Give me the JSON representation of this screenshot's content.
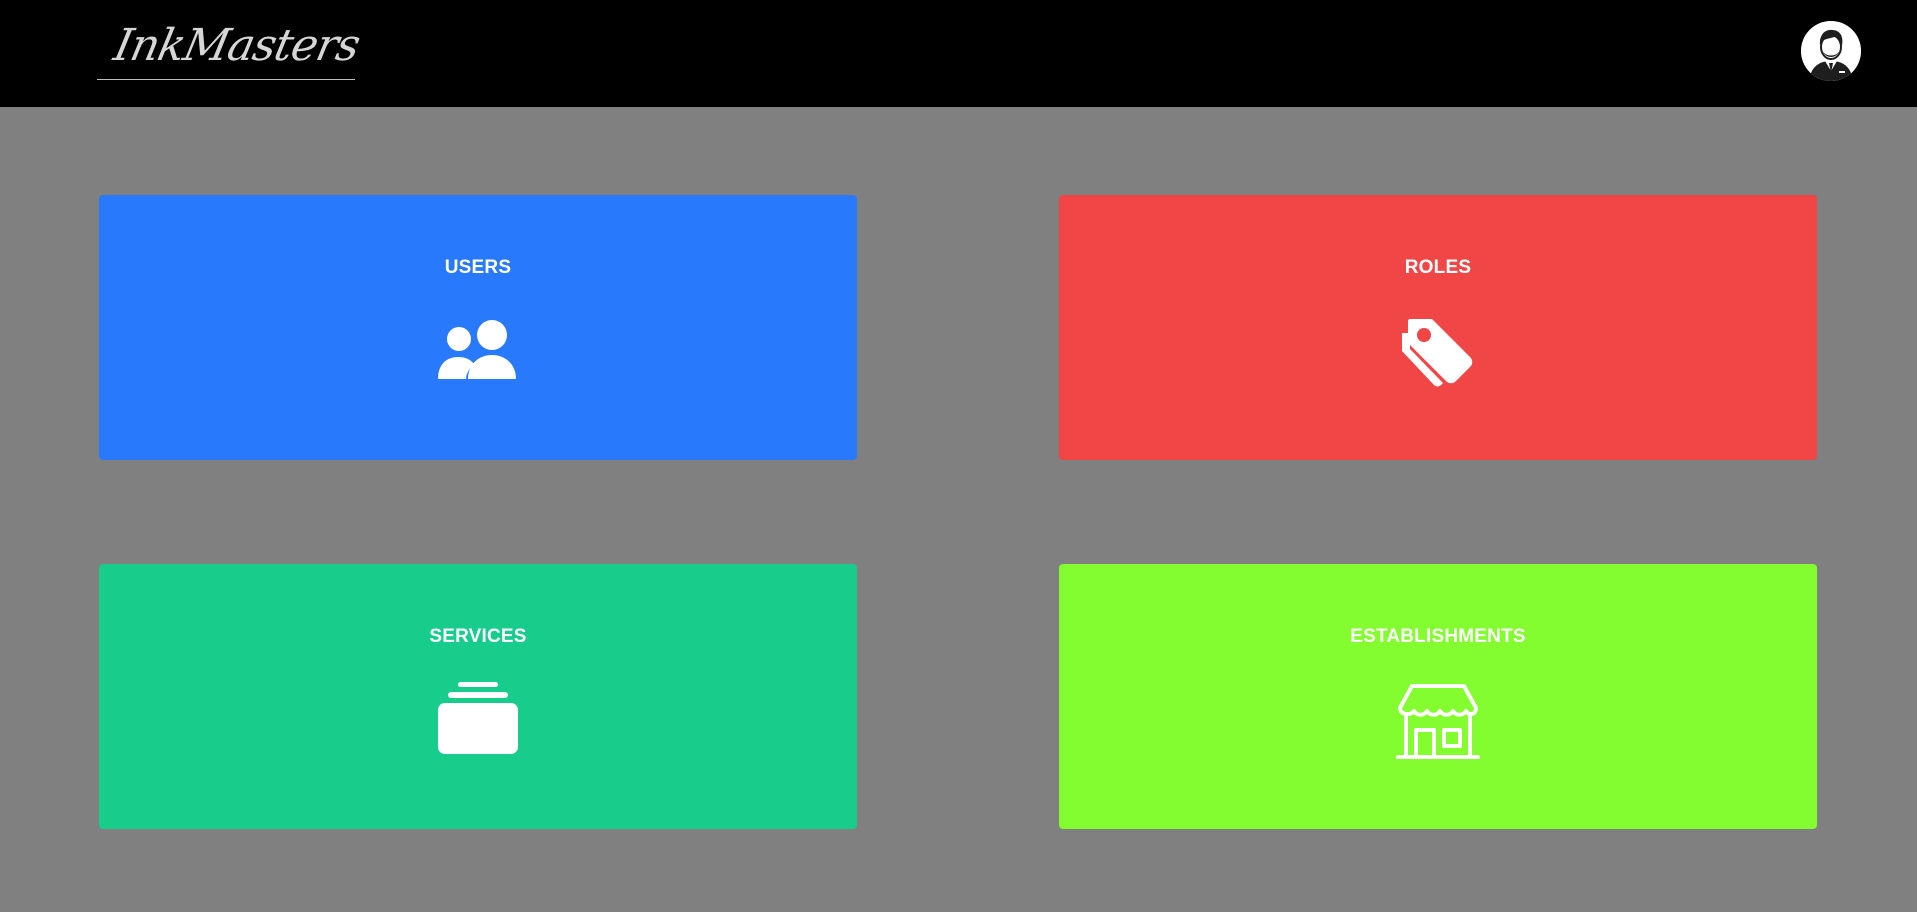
{
  "header": {
    "logo_text": "InkMasters",
    "avatar_icon": "user-avatar-icon"
  },
  "cards": [
    {
      "label": "USERS",
      "icon": "users-icon",
      "color": "#2979fc"
    },
    {
      "label": "ROLES",
      "icon": "tags-icon",
      "color": "#f04646"
    },
    {
      "label": "SERVICES",
      "icon": "layers-icon",
      "color": "#18cc8b"
    },
    {
      "label": "ESTABLISHMENTS",
      "icon": "store-icon",
      "color": "#83fc30"
    }
  ],
  "colors": {
    "topbar": "#000000",
    "background": "#808080"
  }
}
